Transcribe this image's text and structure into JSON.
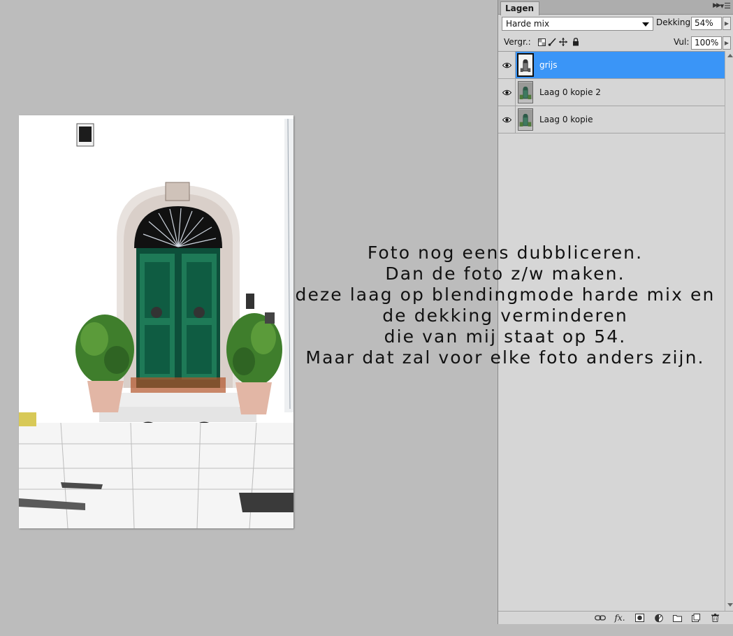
{
  "canvas": {
    "background": "#bcbcbc",
    "overlay_text": [
      "Foto nog eens dubbliceren.",
      "Dan de foto z/w maken.",
      "deze laag op blendingmode harde mix en",
      "de dekking verminderen",
      "die van mij staat op 54.",
      "Maar dat zal voor elke foto anders zijn."
    ]
  },
  "panel": {
    "tab_label": "Lagen",
    "blend_mode": "Harde mix",
    "opacity_label": "Dekking:",
    "opacity_value": "54%",
    "lock_label": "Vergr.:",
    "fill_label": "Vul:",
    "fill_value": "100%",
    "selected_color": "#3a95f7",
    "layers": [
      {
        "name": "grijs",
        "visible": true,
        "selected": true
      },
      {
        "name": "Laag 0 kopie 2",
        "visible": true,
        "selected": false
      },
      {
        "name": "Laag 0 kopie",
        "visible": true,
        "selected": false
      }
    ],
    "footer_icons": [
      "link-layers-icon",
      "fx-icon",
      "add-mask-icon",
      "adjustment-layer-icon",
      "new-group-icon",
      "new-layer-icon",
      "trash-icon"
    ]
  }
}
